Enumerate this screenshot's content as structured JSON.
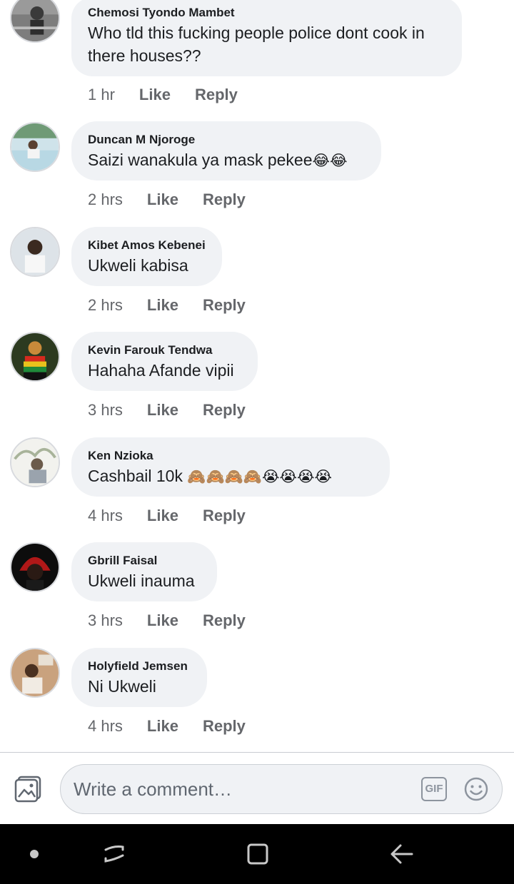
{
  "comments": [
    {
      "author": "Chemosi Tyondo Mambet",
      "text": "Who tld this fucking people police dont cook in there houses??",
      "time": "1 hr",
      "like": "Like",
      "reply": "Reply",
      "avatar": "avatar-photo"
    },
    {
      "author": "Duncan M Njoroge",
      "text": "Saizi wanakula ya mask pekee",
      "emoji": "😂😂",
      "time": "2 hrs",
      "like": "Like",
      "reply": "Reply",
      "avatar": "avatar-photo"
    },
    {
      "author": "Kibet Amos Kebenei",
      "text": "Ukweli kabisa",
      "time": "2 hrs",
      "like": "Like",
      "reply": "Reply",
      "avatar": "avatar-photo"
    },
    {
      "author": "Kevin Farouk Tendwa",
      "text": "Hahaha Afande vipii",
      "time": "3 hrs",
      "like": "Like",
      "reply": "Reply",
      "avatar": "avatar-photo"
    },
    {
      "author": "Ken Nzioka",
      "text": "Cashbail 10k",
      "emoji": "🙈🙈🙈🙈😭😭😭😭",
      "time": "4 hrs",
      "like": "Like",
      "reply": "Reply",
      "avatar": "avatar-photo"
    },
    {
      "author": "Gbrill Faisal",
      "text": "Ukweli inauma",
      "time": "3 hrs",
      "like": "Like",
      "reply": "Reply",
      "avatar": "avatar-photo"
    },
    {
      "author": "Holyfield Jemsen",
      "text": "Ni Ukweli",
      "time": "4 hrs",
      "like": "Like",
      "reply": "Reply",
      "avatar": "avatar-photo"
    }
  ],
  "composer": {
    "placeholder": "Write a comment…",
    "gif_label": "GIF",
    "photo_icon": "photo-icon",
    "emoji_icon": "emoji-icon"
  },
  "navbar": {
    "icons": [
      "dot-icon",
      "recents-icon",
      "home-icon",
      "back-icon"
    ]
  },
  "colors": {
    "bubble": "#f0f2f5",
    "meta": "#65676b",
    "text": "#1c1e21",
    "navbar": "#000000"
  }
}
